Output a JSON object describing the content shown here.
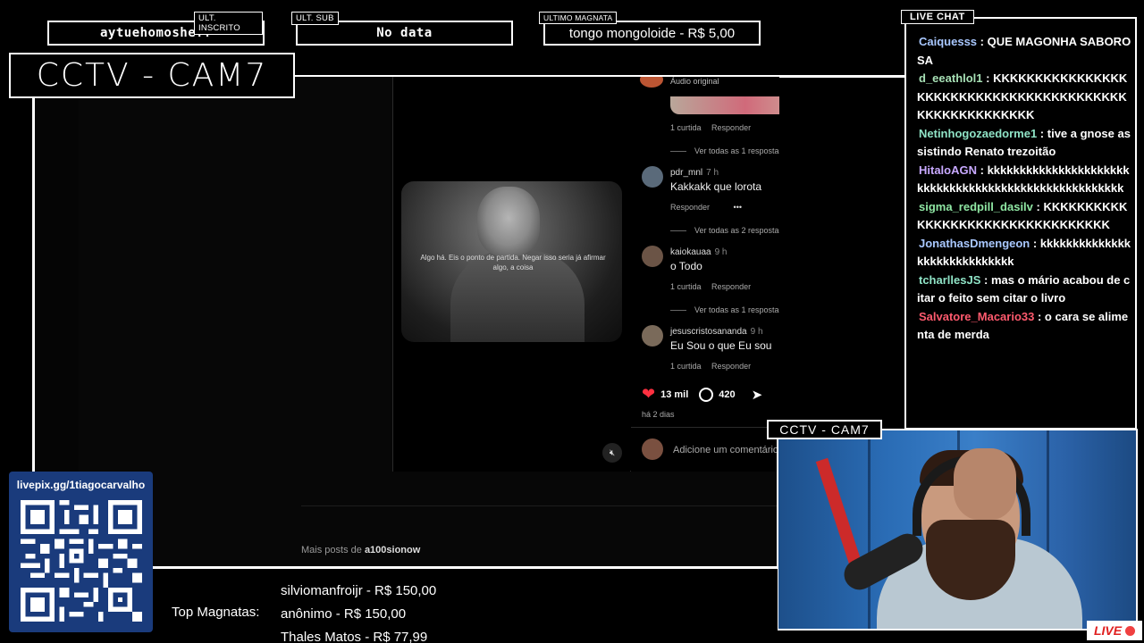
{
  "overlay": {
    "top_boxes": [
      {
        "tag": "ULT. INSCRITO",
        "value": "aytuehomosheff"
      },
      {
        "tag": "ULT. SUB",
        "value": "No data"
      },
      {
        "tag": "ULTIMO MAGNATA",
        "value": "tongo mongoloide - R$ 5,00"
      }
    ],
    "cctv_title": "CCTV - CAM7",
    "cam_tag": "CCTV - CAM7",
    "live_label": "LIVE",
    "qr_url": "livepix.gg/1tiagocarvalho",
    "top_magnatas_label": "Top Magnatas:",
    "top_magnatas": [
      "silviomanfroijr - R$ 150,00",
      "anônimo - R$ 150,00",
      "Thales Matos - R$ 77,99"
    ]
  },
  "chat": {
    "title": "LIVE CHAT",
    "messages": [
      {
        "user": "Caiquesss",
        "color": "#a9c8ff",
        "text": "QUE MAGONHA SABOROSA"
      },
      {
        "user": "d_eeathlol1",
        "color": "#a7e0b5",
        "text": "KKKKKKKKKKKKKKKKKKKKKKKKKKKKKKKKKKKKKKKKKKKKKKKKKKKKKKK"
      },
      {
        "user": "Netinhogozaedorme1",
        "color": "#8fe3c6",
        "text": "tive a gnose assistindo Renato trezoitão"
      },
      {
        "user": "HitaloAGN",
        "color": "#c8a9ff",
        "text": "kkkkkkkkkkkkkkkkkkkkkkkkkkkkkkkkkkkkkkkkkkkkkkkkkkkkkk"
      },
      {
        "user": "sigma_redpill_dasilv",
        "color": "#8fe6a3",
        "text": "KKKKKKKKKKKKKKKKKKKKKKKKKKKKKKKKK"
      },
      {
        "user": "JonathasDmengeon",
        "color": "#a9c8ff",
        "text": "kkkkkkkkkkkkkkkkkkkkkkkkkkkkk"
      },
      {
        "user": "tcharllesJS",
        "color": "#8fe3c6",
        "text": "mas o mário acabou de citar o feito sem citar o livro"
      },
      {
        "user": "Salvatore_Macario33",
        "color": "#ff5a6e",
        "text": "o cara se alimenta de merda"
      }
    ]
  },
  "post": {
    "audio_label": "Áudio original",
    "video_caption": "Algo há. Eis o ponto de partida. Negar isso seria já afirmar algo, a coisa",
    "comments": [
      {
        "likes": "1 curtida",
        "reply": "Responder",
        "view_all": "Ver todas as 1 respostas"
      },
      {
        "user": "pdr_mnl",
        "time": "7 h",
        "text": "Kakkakk que lorota",
        "reply": "Responder",
        "more": "•••",
        "view_all": "Ver todas as 2 respostas"
      },
      {
        "user": "kaiokauaa",
        "time": "9 h",
        "text": "o Todo",
        "likes": "1 curtida",
        "reply": "Responder",
        "view_all": "Ver todas as 1 respostas"
      },
      {
        "user": "jesuscristosananda",
        "time": "9 h",
        "text": "Eu Sou o que Eu sou",
        "likes": "1 curtida",
        "reply": "Responder"
      }
    ],
    "like_count": "13 mil",
    "comment_count": "420",
    "date": "há 2 dias",
    "add_comment_placeholder": "Adicione um comentário...",
    "more_posts_prefix": "Mais posts de",
    "more_posts_user": "a100sionow"
  },
  "colors": {
    "overlay_border": "#ffffff",
    "qr_background": "#1a3b7c",
    "heart_red": "#ff3040",
    "live_red": "#e02020",
    "webcam_backdrop": "#2a6cb5"
  }
}
